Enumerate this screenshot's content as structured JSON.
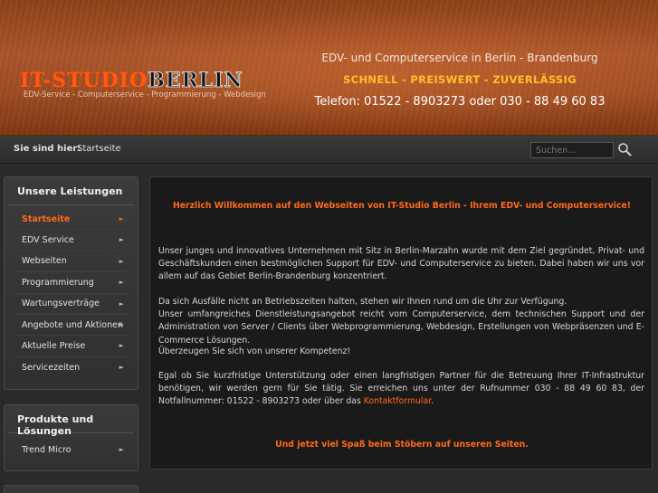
{
  "header": {
    "logo_it": "IT-STUDIO",
    "logo_berlin": "BERLIN",
    "logo_subtitle": "EDV-Service - Computerservice - Programmierung - Webdesign",
    "tagline_1": "EDV- und Computerservice in Berlin - Brandenburg",
    "tagline_2": "SCHNELL - PREISWERT - ZUVERLÄSSIG",
    "tagline_3": "Telefon: 01522 - 8903273  oder  030 - 88 49 60 83"
  },
  "breadcrumb": {
    "label": "Sie sind hier:",
    "current": "Startseite"
  },
  "search": {
    "placeholder": "Suchen..."
  },
  "sidebar": {
    "services_title": "Unsere Leistungen",
    "services_items": [
      {
        "label": "Startseite"
      },
      {
        "label": "EDV Service"
      },
      {
        "label": "Webseiten"
      },
      {
        "label": "Programmierung"
      },
      {
        "label": "Wartungsverträge"
      },
      {
        "label": "Angebote und Aktionen"
      },
      {
        "label": "Aktuelle Preise"
      },
      {
        "label": "Servicezeiten"
      }
    ],
    "products_title": "Produkte und Lösungen",
    "products_items": [
      {
        "label": "Trend Micro"
      }
    ],
    "arrow": "►"
  },
  "main": {
    "welcome": "Herzlich Willkommen auf den Webseiten von IT-Studio Berlin - Ihrem EDV- und Computerservice!",
    "p1": "Unser junges und innovatives Unternehmen mit Sitz in Berlin-Marzahn wurde mit dem Ziel gegründet, Privat- und Geschäftskunden einen bestmöglichen Support für EDV- und Computerservice zu bieten. Dabei haben wir uns vor allem auf das Gebiet Berlin-Brandenburg konzentriert.",
    "p2a": "Da sich Ausfälle nicht an Betriebszeiten halten, stehen wir Ihnen rund um die Uhr zur Verfügung.",
    "p2b": "Unser umfangreiches Dienstleistungsangebot reicht vom Computerservice, dem technischen Support und der Administration von Server / Clients über Webprogrammierung, Webdesign, Erstellungen von Webpräsenzen und E-Commerce Lösungen.",
    "p3": "Überzeugen Sie sich von unserer Kompetenz!",
    "p4": "Egal ob Sie kurzfristige Unterstützung oder einen langfristigen Partner für die Betreuung Ihrer IT-Infrastruktur benötigen, wir werden gern für Sie tätig. Sie erreichen uns unter der Rufnummer 030 - 88 49 60 83, der Notfallnummer: 01522 - 8903273 oder über das",
    "p4_link": "Kontaktformular",
    "p4_end": ".",
    "closing": "Und jetzt viel Spaß beim Stöbern auf unseren Seiten."
  },
  "colors": {
    "accent": "#ff6a1a",
    "tagline_yellow": "#ffc02a",
    "header_orange": "#a8542a"
  }
}
